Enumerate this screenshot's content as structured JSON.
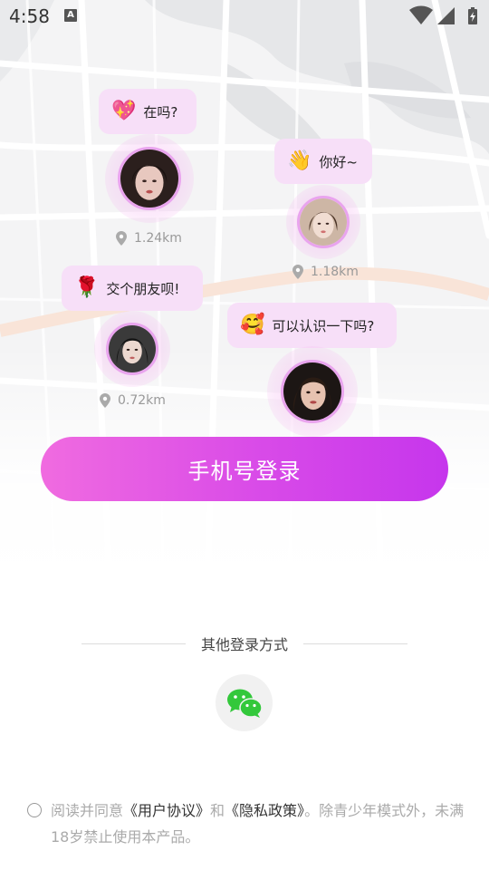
{
  "status_bar": {
    "time": "4:58",
    "notification_badge": "A",
    "icons": [
      "wifi-icon",
      "signal-icon",
      "battery-charging-icon"
    ]
  },
  "nearby_users": [
    {
      "greeting_emoji": "💖",
      "greeting": "在吗?",
      "distance": "1.24km"
    },
    {
      "greeting_emoji": "👋",
      "greeting": "你好~",
      "distance": "1.18km"
    },
    {
      "greeting_emoji": "🌹",
      "greeting": "交个朋友呗!",
      "distance": "0.72km"
    },
    {
      "greeting_emoji": "🥰",
      "greeting": "可以认识一下吗?",
      "distance": ""
    }
  ],
  "login": {
    "phone_login_label": "手机号登录",
    "other_methods_label": "其他登录方式",
    "wechat_icon": "wechat-icon"
  },
  "agreement": {
    "prefix": "阅读并同意",
    "user_agreement": "《用户协议》",
    "and": "和",
    "privacy_policy": "《隐私政策》",
    "suffix": "。除青少年模式外，未满18岁禁止使用本产品。"
  },
  "colors": {
    "accent_start": "#f06be0",
    "accent_end": "#c636ec",
    "bubble_bg": "#f7dff8",
    "avatar_ring": "#e9a4ee",
    "wechat_green": "#33c83b"
  }
}
